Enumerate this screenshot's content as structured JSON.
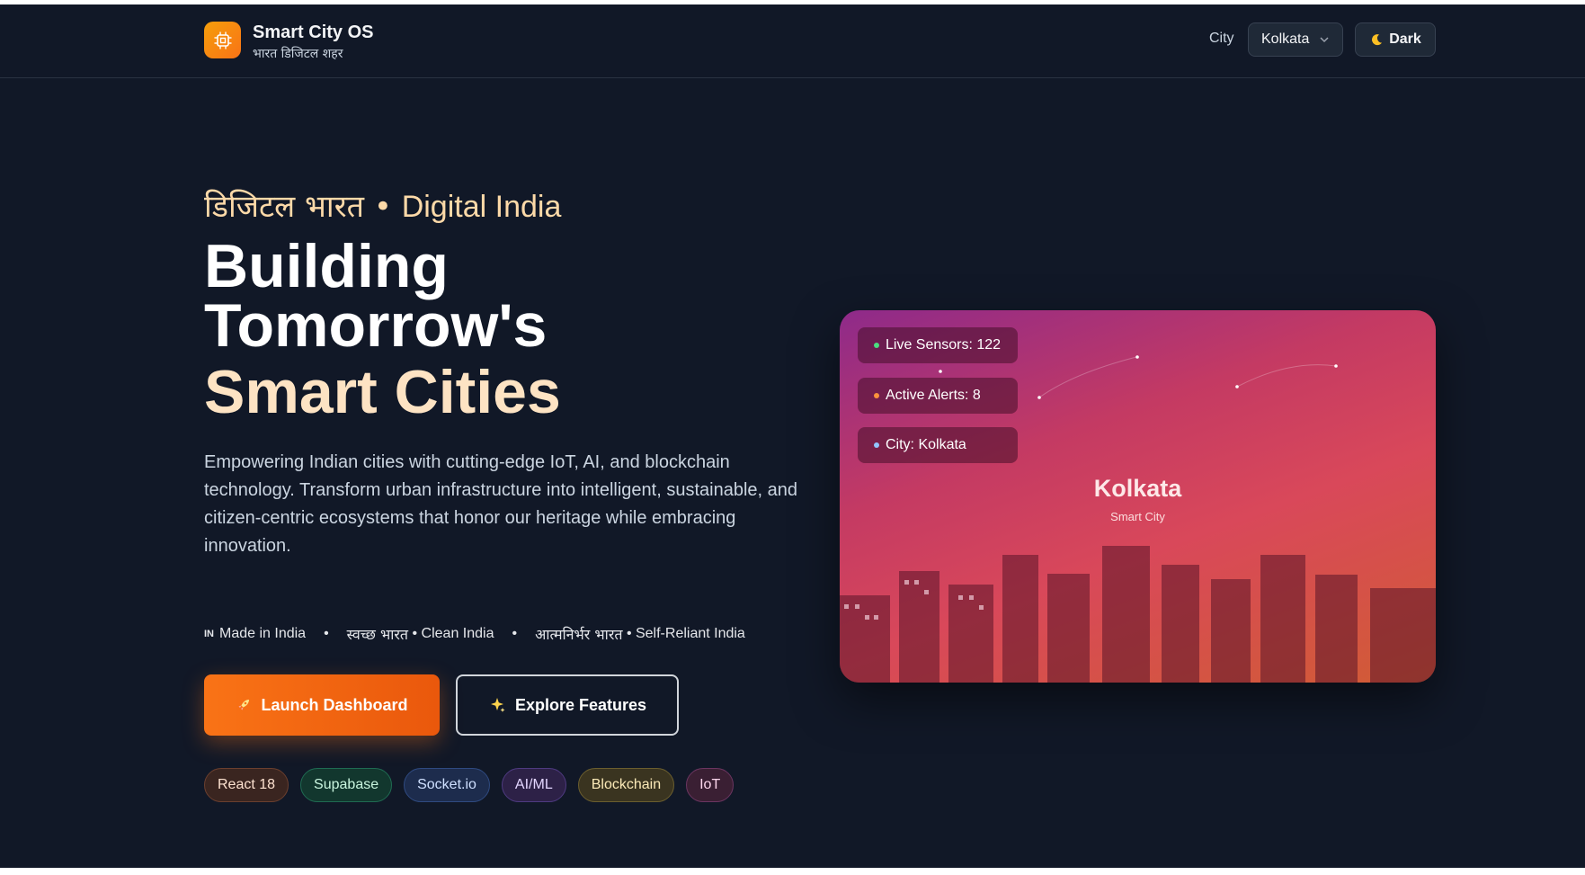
{
  "header": {
    "brand_title": "Smart City OS",
    "brand_subtitle": "भारत डिजिटल शहर",
    "city_label": "City",
    "city_selected": "Kolkata",
    "theme_toggle": {
      "icon": "moon-icon",
      "label": "Dark"
    }
  },
  "hero": {
    "eyebrow_hindi": "डिजिटल भारत",
    "eyebrow_separator": " • ",
    "eyebrow_english": "Digital India",
    "headline_line1": "Building",
    "headline_line2": "Tomorrow's",
    "headline_accent": "Smart Cities",
    "description": "Empowering Indian cities with cutting-edge IoT, AI, and blockchain technology. Transform urban infrastructure into intelligent, sustainable, and citizen-centric ecosystems that honor our heritage while embracing innovation.",
    "tags": [
      {
        "prefix": "IN",
        "label": "Made in India"
      },
      {
        "hindi": "स्वच्छ भारत",
        "label": "• Clean India"
      },
      {
        "hindi": "आत्मनिर्भर भारत",
        "label": "• Self-Reliant India"
      }
    ],
    "primary_button": {
      "icon": "rocket-icon",
      "label": "Launch Dashboard"
    },
    "secondary_button": {
      "icon": "sparkles-icon",
      "label": "Explore Features"
    },
    "tech_chips": [
      "React 18",
      "Supabase",
      "Socket.io",
      "AI/ML",
      "Blockchain",
      "IoT"
    ]
  },
  "city_card": {
    "pills": [
      {
        "label": "Live Sensors: 122",
        "color": "#4ade80"
      },
      {
        "label": "Active Alerts: 8",
        "color": "#fb923c"
      },
      {
        "label": "City: Kolkata",
        "color": "#93c5fd"
      }
    ],
    "city_name": "Kolkata",
    "city_subtitle": "Smart City"
  },
  "colors": {
    "background": "#111827",
    "accent": "#f97316",
    "accent_text": "#fde3c3"
  }
}
